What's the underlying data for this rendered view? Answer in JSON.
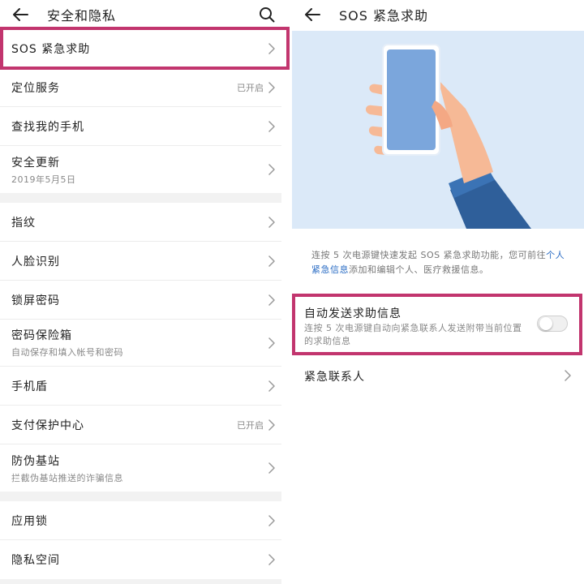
{
  "left": {
    "title": "安全和隐私",
    "groups": [
      [
        {
          "label": "SOS 紧急求助"
        },
        {
          "label": "定位服务",
          "value": "已开启"
        },
        {
          "label": "查找我的手机"
        },
        {
          "label": "安全更新",
          "sub": "2019年5月5日"
        }
      ],
      [
        {
          "label": "指纹"
        },
        {
          "label": "人脸识别"
        },
        {
          "label": "锁屏密码"
        },
        {
          "label": "密码保险箱",
          "sub": "自动保存和填入帐号和密码"
        },
        {
          "label": "手机盾"
        },
        {
          "label": "支付保护中心",
          "value": "已开启"
        },
        {
          "label": "防伪基站",
          "sub": "拦截伪基站推送的诈骗信息"
        }
      ],
      [
        {
          "label": "应用锁"
        },
        {
          "label": "隐私空间"
        }
      ]
    ]
  },
  "right": {
    "title": "SOS 紧急求助",
    "description": {
      "before": "连按 5 次电源键快速发起 SOS 紧急求助功能，您可前往",
      "link": "个人紧急信息",
      "after": "添加和编辑个人、医疗救援信息。"
    },
    "auto_send": {
      "title": "自动发送求助信息",
      "desc": "连按 5 次电源键自动向紧急联系人发送附带当前位置的求助信息",
      "enabled": false
    },
    "contacts_label": "紧急联系人"
  },
  "colors": {
    "highlight": "#c2356e",
    "link": "#2a6cc4",
    "hero_bg": "#dbe9f8"
  },
  "icons": {
    "back": "arrow-left-icon",
    "search": "search-icon",
    "chevron": "chevron-right-icon"
  }
}
